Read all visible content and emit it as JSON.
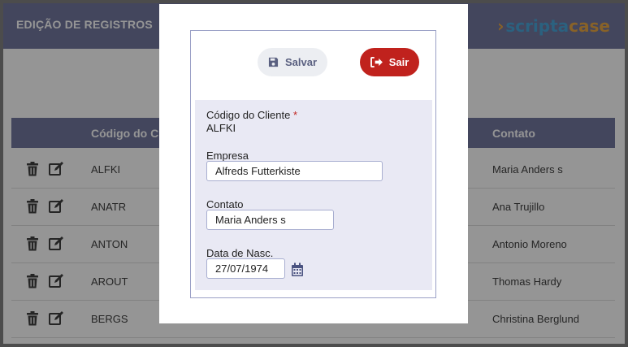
{
  "app": {
    "title": "EDIÇÃO DE REGISTROS",
    "logo_part1": "scripta",
    "logo_part2": "case"
  },
  "table": {
    "headers": [
      "Código do Cli",
      "Contato"
    ],
    "rows": [
      {
        "code": "ALFKI",
        "contact": "Maria Anders s"
      },
      {
        "code": "ANATR",
        "contact": "Ana Trujillo"
      },
      {
        "code": "ANTON",
        "contact": "Antonio Moreno"
      },
      {
        "code": "AROUT",
        "contact": "Thomas Hardy"
      },
      {
        "code": "BERGS",
        "contact": "Christina Berglund"
      }
    ]
  },
  "modal": {
    "save_label": "Salvar",
    "exit_label": "Sair",
    "fields": {
      "codigo_label": "Código do Cliente",
      "codigo_required": "*",
      "codigo_value": "ALFKI",
      "empresa_label": "Empresa",
      "empresa_value": "Alfreds Futterkiste",
      "contato_label": "Contato",
      "contato_value": "Maria Anders s",
      "nasc_label": "Data de Nasc.",
      "nasc_value": "27/07/1974"
    }
  },
  "colors": {
    "header_bg": "#6a6f9a",
    "exit_button": "#c0221d",
    "form_bg": "#e9e9f4"
  },
  "icons": [
    "trash-icon",
    "edit-icon",
    "save-icon",
    "exit-icon",
    "calendar-icon"
  ]
}
